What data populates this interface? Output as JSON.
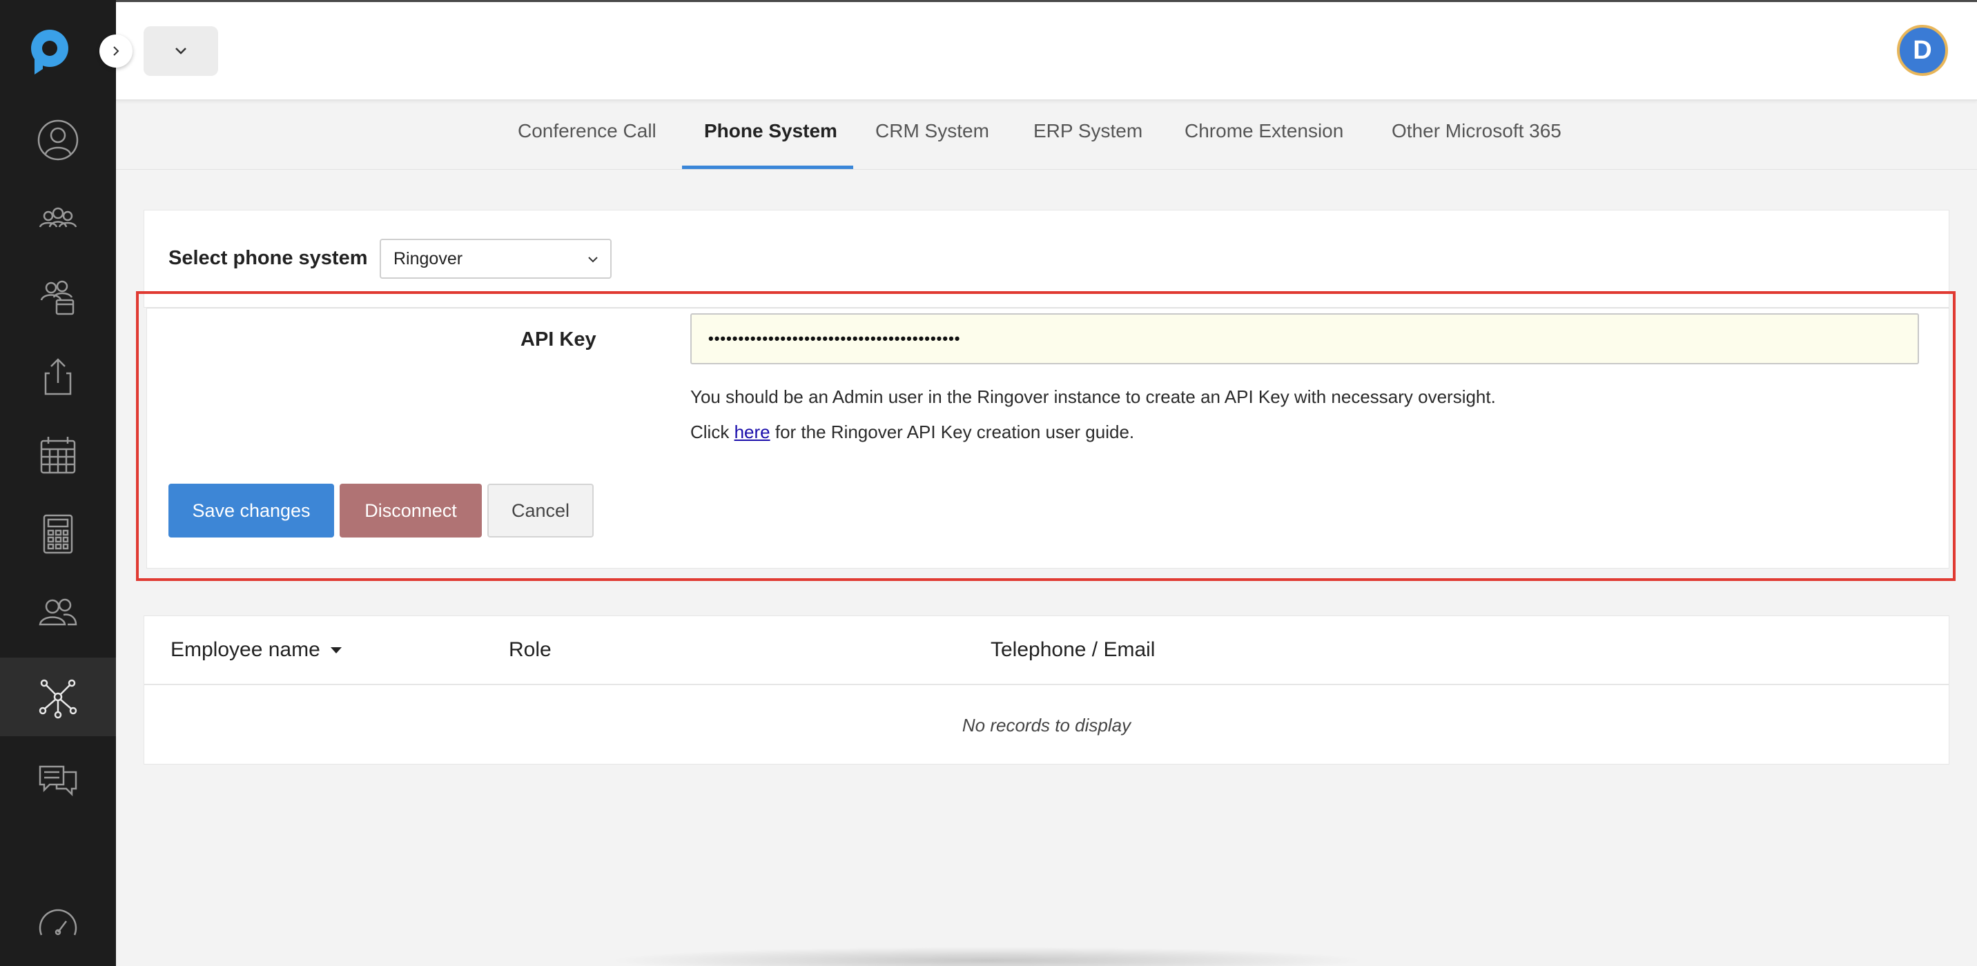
{
  "topbar": {
    "org_selector_icon": "chevron-down-icon",
    "avatar_initial": "D"
  },
  "sidebar": {
    "items": [
      {
        "icon": "user-circle-icon"
      },
      {
        "icon": "group-icon"
      },
      {
        "icon": "team-calendar-icon"
      },
      {
        "icon": "share-upload-icon"
      },
      {
        "icon": "calendar-icon"
      },
      {
        "icon": "calculator-icon"
      },
      {
        "icon": "people-icon"
      },
      {
        "icon": "integrations-network-icon",
        "active": true
      },
      {
        "icon": "chat-bubbles-icon"
      },
      {
        "icon": "dashboard-gauge-icon"
      }
    ]
  },
  "tabs": [
    {
      "label": "Conference Call"
    },
    {
      "label": "Phone System",
      "active": true
    },
    {
      "label": "CRM System"
    },
    {
      "label": "ERP System"
    },
    {
      "label": "Chrome Extension"
    },
    {
      "label": "Other Microsoft 365"
    }
  ],
  "phone_system": {
    "select_label": "Select phone system",
    "selected_value": "Ringover"
  },
  "api": {
    "label": "API Key",
    "value": "••••••••••••••••••••••••••••••••••••••••••",
    "help_line1": "You should be an Admin user in the Ringover instance to create an API Key with necessary oversight.",
    "help_click": "Click",
    "help_link": "here",
    "help_rest": "for the Ringover API Key creation user guide."
  },
  "buttons": {
    "save": "Save changes",
    "disconnect": "Disconnect",
    "cancel": "Cancel"
  },
  "table": {
    "columns": [
      "Employee name",
      "Role",
      "Telephone / Email"
    ],
    "sort_column": "Employee name",
    "empty_message": "No records to display"
  },
  "colors": {
    "sidebar": "#1d1d1d",
    "accent": "#3d86d6",
    "disconnect": "#b07374",
    "highlight": "#e03a32"
  }
}
